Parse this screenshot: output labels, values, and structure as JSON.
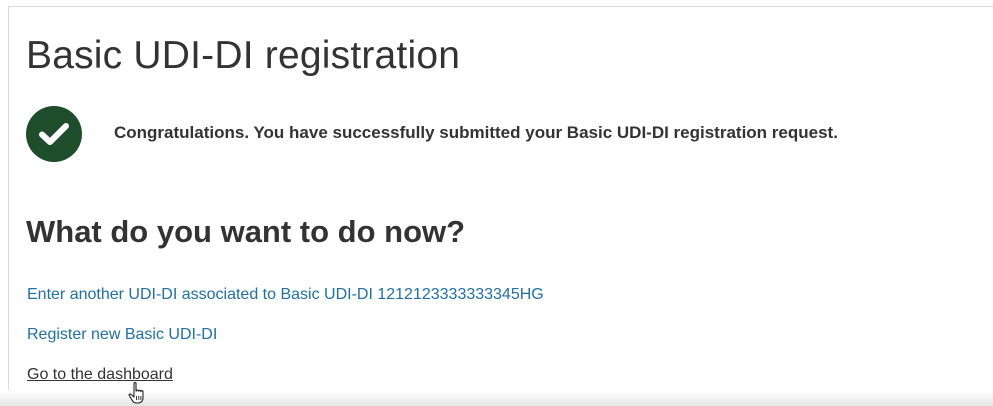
{
  "page": {
    "title": "Basic UDI-DI registration"
  },
  "confirmation": {
    "icon": "check-circle-icon",
    "icon_color": "#1e4d2b",
    "message": "Congratulations. You have successfully submitted your Basic UDI-DI registration request."
  },
  "next_steps": {
    "heading": "What do you want to do now?",
    "links": [
      {
        "label": "Enter another UDI-DI associated to Basic UDI-DI 1212123333333345HG",
        "color": "#1f6fa8"
      },
      {
        "label": "Register new Basic UDI-DI",
        "color": "#1f6fa8"
      },
      {
        "label": "Go to the dashboard",
        "color": "#333333"
      }
    ]
  },
  "cursor": {
    "icon": "hand-pointer-icon"
  }
}
